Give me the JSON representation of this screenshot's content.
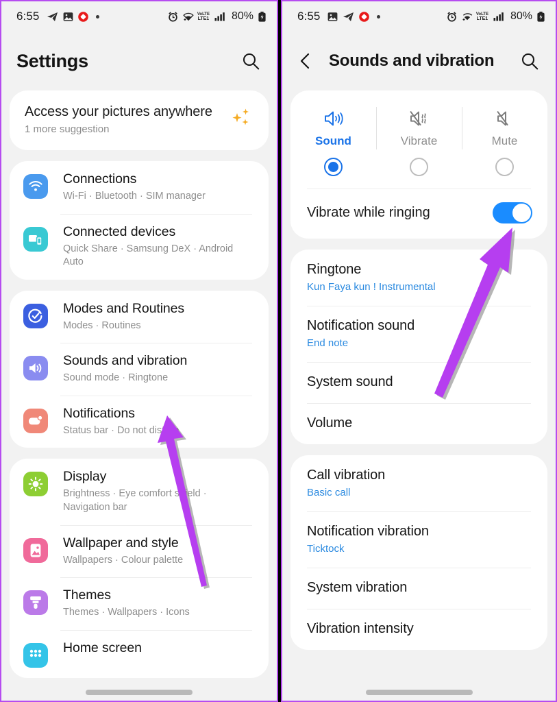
{
  "left_phone": {
    "status_bar": {
      "time": "6:55",
      "icons": [
        "telegram-icon",
        "gallery-icon",
        "record-icon",
        "dot-icon"
      ],
      "network": "LTE1",
      "volte": "VoLTE",
      "battery_percent": "80%"
    },
    "header": {
      "title": "Settings",
      "search_icon": "search-icon"
    },
    "suggestion": {
      "title": "Access your pictures anywhere",
      "subtitle": "1 more suggestion",
      "icon": "sparkles-icon"
    },
    "groups": [
      {
        "items": [
          {
            "title": "Connections",
            "subtitle": "Wi-Fi  ·  Bluetooth  ·  SIM manager",
            "icon": "wifi-icon",
            "icon_color": "#4a9aee"
          },
          {
            "title": "Connected devices",
            "subtitle": "Quick Share  ·  Samsung DeX  ·  Android Auto",
            "icon": "devices-icon",
            "icon_color": "#39c9d3"
          }
        ]
      },
      {
        "items": [
          {
            "title": "Modes and Routines",
            "subtitle": "Modes  ·  Routines",
            "icon": "modes-icon",
            "icon_color": "#3b5fe0"
          },
          {
            "title": "Sounds and vibration",
            "subtitle": "Sound mode  ·  Ringtone",
            "icon": "sound-icon",
            "icon_color": "#8a8cf0"
          },
          {
            "title": "Notifications",
            "subtitle": "Status bar  ·  Do not disturb",
            "icon": "notifications-icon",
            "icon_color": "#f08878"
          }
        ]
      },
      {
        "items": [
          {
            "title": "Display",
            "subtitle": "Brightness  ·  Eye comfort shield  ·  Navigation bar",
            "icon": "brightness-icon",
            "icon_color": "#8dce33"
          },
          {
            "title": "Wallpaper and style",
            "subtitle": "Wallpapers  ·  Colour palette",
            "icon": "wallpaper-icon",
            "icon_color": "#f06a9a"
          },
          {
            "title": "Themes",
            "subtitle": "Themes  ·  Wallpapers  ·  Icons",
            "icon": "themes-icon",
            "icon_color": "#bb7ae8"
          },
          {
            "title": "Home screen",
            "subtitle": "",
            "icon": "home-screen-icon",
            "icon_color": "#34c4e8"
          }
        ]
      }
    ]
  },
  "right_phone": {
    "status_bar": {
      "time": "6:55",
      "icons": [
        "gallery-icon",
        "telegram-icon",
        "record-icon",
        "dot-icon"
      ],
      "network": "LTE1",
      "volte": "VoLTE",
      "battery_percent": "80%"
    },
    "header": {
      "back_icon": "back-chevron-icon",
      "title": "Sounds and vibration",
      "search_icon": "search-icon"
    },
    "sound_mode": {
      "options": [
        {
          "label": "Sound",
          "icon": "speaker-on-icon",
          "selected": true
        },
        {
          "label": "Vibrate",
          "icon": "speaker-vibrate-icon",
          "selected": false
        },
        {
          "label": "Mute",
          "icon": "speaker-mute-icon",
          "selected": false
        }
      ],
      "vibrate_while_ringing": {
        "label": "Vibrate while ringing",
        "enabled": true
      }
    },
    "sound_group": [
      {
        "title": "Ringtone",
        "value": "Kun Faya kun ! Instrumental"
      },
      {
        "title": "Notification sound",
        "value": "End note"
      },
      {
        "title": "System sound",
        "value": ""
      },
      {
        "title": "Volume",
        "value": ""
      }
    ],
    "vibration_group": [
      {
        "title": "Call vibration",
        "value": "Basic call"
      },
      {
        "title": "Notification vibration",
        "value": "Ticktock"
      },
      {
        "title": "System vibration",
        "value": ""
      },
      {
        "title": "Vibration intensity",
        "value": ""
      }
    ]
  },
  "annotations": {
    "accent_color": "#b84cf0",
    "arrow_left": "points-to-sounds-and-vibration",
    "arrow_right": "points-to-vibrate-while-ringing-toggle"
  }
}
